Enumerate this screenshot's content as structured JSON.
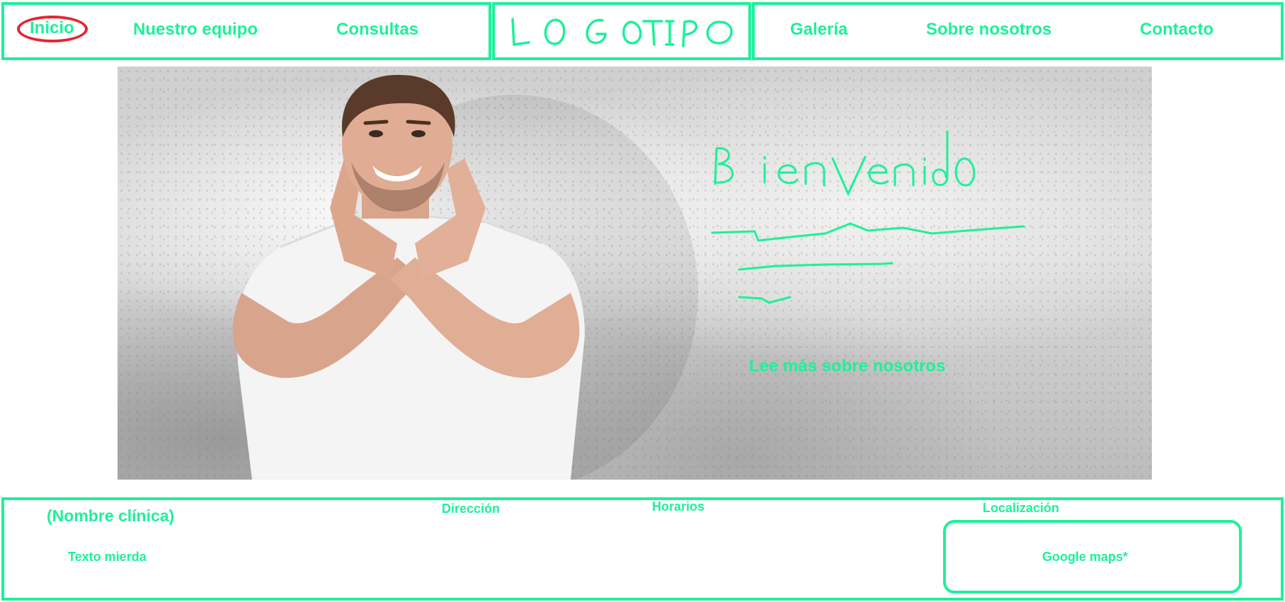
{
  "header": {
    "logo_text": "LOG OTIPO",
    "nav_left": [
      "Inicio",
      "Nuestro equipo",
      "Consultas"
    ],
    "nav_right": [
      "Galería",
      "Sobre nosotros",
      "Contacto"
    ],
    "active": "Inicio"
  },
  "hero": {
    "heading": "Bienvenido",
    "cta": "Lee más sobre nosotros"
  },
  "footer": {
    "clinic_name": "(Nombre clínica)",
    "text": "Texto mierda",
    "address_label": "Dirección",
    "hours_label": "Horarios",
    "location_label": "Localización",
    "map_placeholder": "Google maps*"
  },
  "colors": {
    "accent": "#1ef09a",
    "active_ring": "#e32630"
  }
}
